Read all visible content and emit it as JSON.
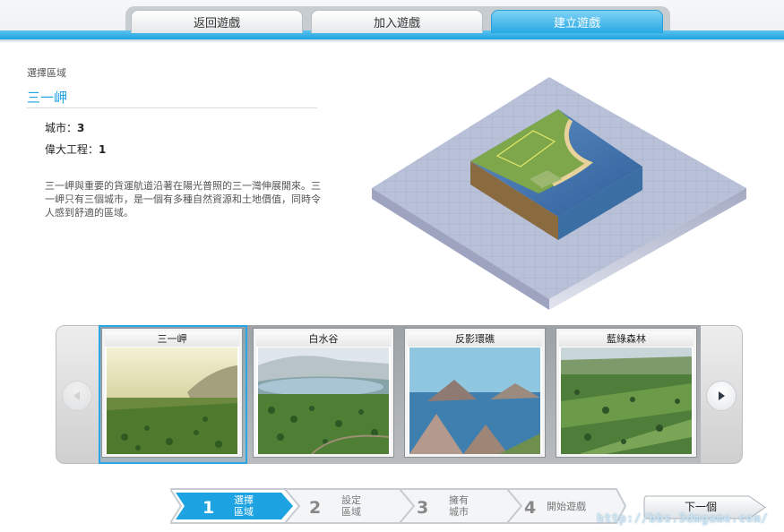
{
  "tabs": [
    {
      "label": "返回遊戲",
      "active": false
    },
    {
      "label": "加入遊戲",
      "active": false
    },
    {
      "label": "建立遊戲",
      "active": true
    }
  ],
  "region": {
    "section_label": "選擇區域",
    "name": "三一岬",
    "stats": [
      {
        "label": "城市：",
        "value": "3"
      },
      {
        "label": "偉大工程：",
        "value": "1"
      }
    ],
    "description": "三一岬與重要的貨運航道沿著在陽光普照的三一灣伸展開來。三一岬只有三個城市，是一個有多種自然資源和土地價值，同時令人感到舒適的區域。"
  },
  "carousel": {
    "prev_enabled": false,
    "next_enabled": true,
    "items": [
      {
        "name": "三一岬",
        "selected": true
      },
      {
        "name": "白水谷",
        "selected": false
      },
      {
        "name": "反影環礁",
        "selected": false
      },
      {
        "name": "藍綠森林",
        "selected": false
      }
    ]
  },
  "steps": [
    {
      "number": "1",
      "label_line1": "選擇",
      "label_line2": "區域",
      "active": true
    },
    {
      "number": "2",
      "label_line1": "設定",
      "label_line2": "區域",
      "active": false
    },
    {
      "number": "3",
      "label_line1": "擁有",
      "label_line2": "城市",
      "active": false
    },
    {
      "number": "4",
      "label_line1": "開始遊戲",
      "label_line2": "",
      "active": false
    }
  ],
  "next_button": {
    "label": "下一個"
  },
  "watermark": "http://bbs.3dmgame.com/",
  "colors": {
    "accent": "#1ea3e2",
    "tab_active": "#27a9e4",
    "step_active": "#1ea3e2"
  },
  "icons": {
    "prev": "chevron-left-icon",
    "next": "chevron-right-icon"
  }
}
